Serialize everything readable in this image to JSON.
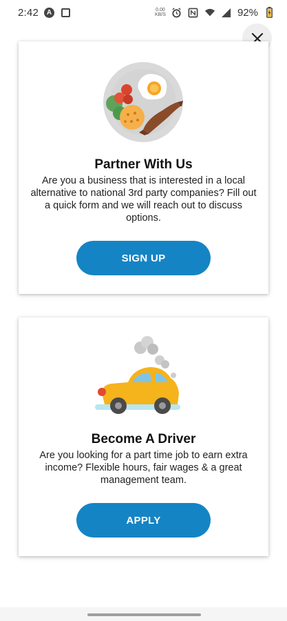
{
  "status_bar": {
    "time": "2:42",
    "left_icons": [
      "app-a-icon",
      "image-icon"
    ],
    "right_icons": [
      "data-speed-icon",
      "alarm-icon",
      "nfc-icon",
      "wifi-icon",
      "signal-icon",
      "battery-charging-icon"
    ],
    "data_speed": "0.00\nKB/S",
    "battery_percent": "92%"
  },
  "close": {
    "icon": "close-icon"
  },
  "cards": [
    {
      "illustration": "breakfast-plate",
      "title": "Partner With Us",
      "text": "Are you a business that is interested in a local alternative to national 3rd party companies? Fill out a quick form and we will reach out to discuss options.",
      "button_label": "SIGN UP"
    },
    {
      "illustration": "car",
      "title": "Become A Driver",
      "text": "Are you looking for a part time job to earn extra income? Flexible hours, fair wages & a great management team.",
      "button_label": "APPLY"
    }
  ],
  "colors": {
    "accent": "#1584c4",
    "car_body": "#f5b31c",
    "plate": "#d9d9d9"
  }
}
